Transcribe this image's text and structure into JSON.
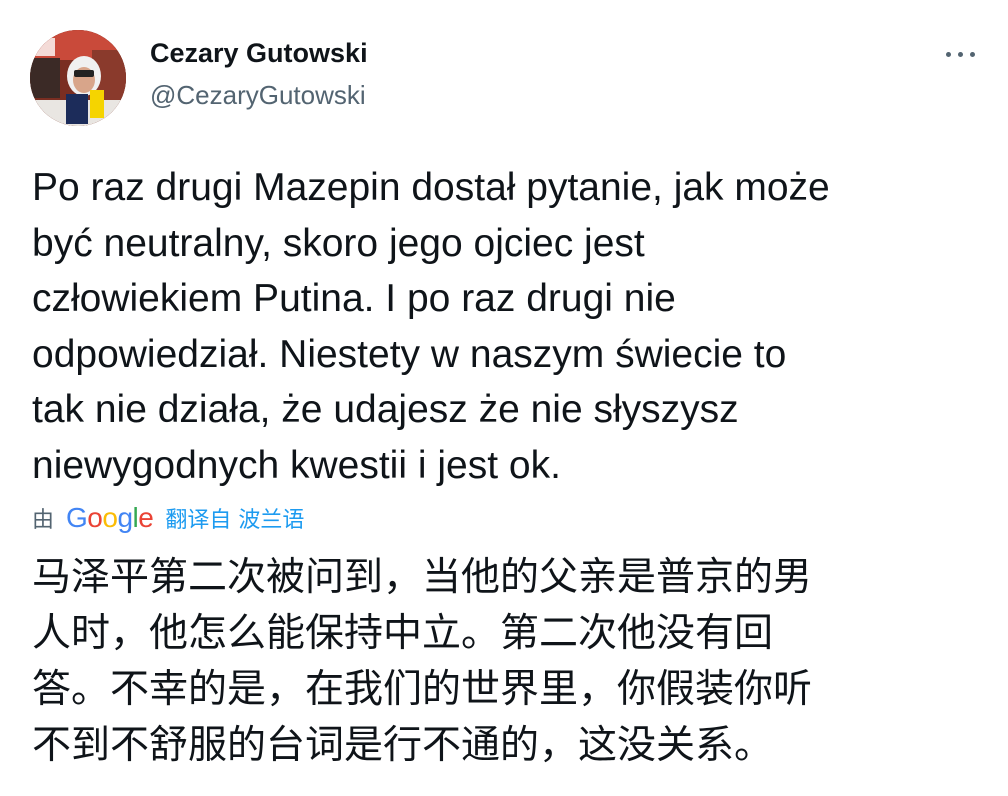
{
  "author": {
    "display_name": "Cezary Gutowski",
    "handle": "@CezaryGutowski",
    "avatar": "avatar-photo-rally-driver-helmet"
  },
  "more_menu_icon": "more-horizontal-icon",
  "tweet": {
    "text": "Po raz drugi Mazepin dostał pytanie, jak może\nbyć neutralny, skoro jego ojciec jest\nczłowiekiem Putina. I po raz drugi nie\nodpowiedział. Niestety w naszym świecie to\ntak nie działa, że udajesz że nie słyszysz\nniewygodnych kwestii i jest ok."
  },
  "translation": {
    "by_label": "由",
    "provider_logo": "Google",
    "link_label": "翻译自 波兰语",
    "text": "马泽平第二次被问到，当他的父亲是普京的男\n人时，他怎么能保持中立。第二次他没有回\n答。不幸的是，在我们的世界里，你假装你听\n不到不舒服的台词是行不通的，这没关系。"
  },
  "colors": {
    "text_primary": "#0f1419",
    "text_secondary": "#536471",
    "link": "#1d9bf0",
    "google_blue": "#4285F4",
    "google_red": "#EA4335",
    "google_yellow": "#FBBC05",
    "google_green": "#34A853"
  }
}
